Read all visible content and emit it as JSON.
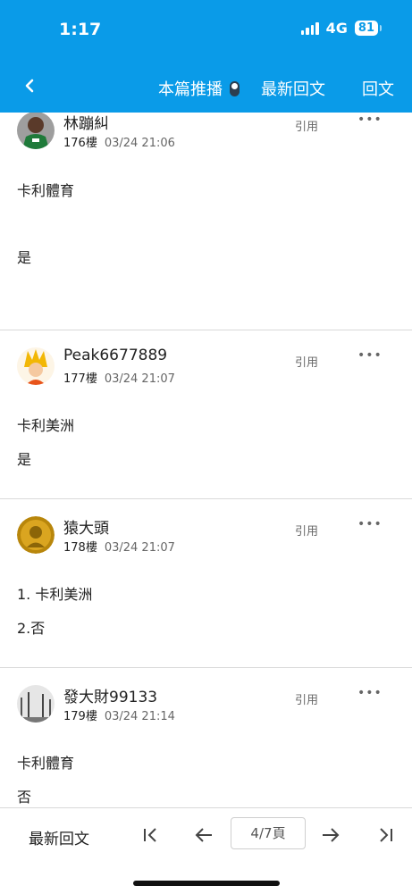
{
  "status_bar": {
    "time": "1:17",
    "network": "4G",
    "battery": "81"
  },
  "nav": {
    "back_icon": "chevron-left-icon",
    "push_label": "本篇推播",
    "latest_label": "最新回文",
    "reply_label": "回文"
  },
  "posts": [
    {
      "author": "林蹦糾",
      "floor": "176樓",
      "time": "03/24 21:06",
      "quote_label": "引用",
      "more": "•••",
      "lines": [
        "卡利體育",
        "是"
      ]
    },
    {
      "author": "Peak6677889",
      "floor": "177樓",
      "time": "03/24 21:07",
      "quote_label": "引用",
      "more": "•••",
      "lines": [
        "卡利美洲",
        "是"
      ]
    },
    {
      "author": "猿大頭",
      "floor": "178樓",
      "time": "03/24 21:07",
      "quote_label": "引用",
      "more": "•••",
      "lines": [
        "1. 卡利美洲",
        "2.否"
      ]
    },
    {
      "author": "發大財99133",
      "floor": "179樓",
      "time": "03/24 21:14",
      "quote_label": "引用",
      "more": "•••",
      "lines": [
        "卡利體育",
        "否"
      ]
    }
  ],
  "bottom_bar": {
    "latest_label": "最新回文",
    "page_indicator": "4/7頁"
  },
  "colors": {
    "header_bg": "#0a9be8"
  }
}
